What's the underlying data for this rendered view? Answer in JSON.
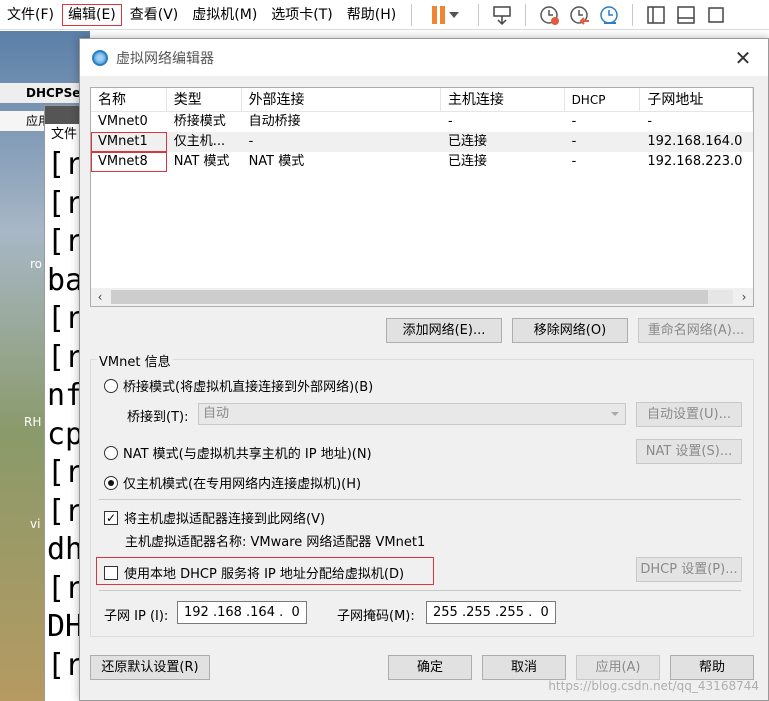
{
  "menubar": {
    "items": [
      "文件(F)",
      "编辑(E)",
      "查看(V)",
      "虚拟机(M)",
      "选项卡(T)",
      "帮助(H)"
    ],
    "highlighted_item": "编辑(E)",
    "accent_pause_color": "#f08533"
  },
  "background": {
    "vm_tab": "DHCPSer",
    "apps_menu": "应用程序",
    "terminal_menu": "文件",
    "terminal_lines": [
      "[r",
      "[r",
      "[r",
      "ba",
      "[r",
      "[r",
      "nf",
      "cp",
      "[r",
      "[r",
      "dh",
      "[r",
      "DH",
      "[r"
    ],
    "side_labels": [
      "ro",
      "RH",
      "vi"
    ]
  },
  "dialog": {
    "title": "虚拟网络编辑器",
    "close_icon": "close-icon",
    "table": {
      "headers": [
        "名称",
        "类型",
        "外部连接",
        "主机连接",
        "DHCP",
        "子网地址"
      ],
      "rows": [
        [
          "VMnet0",
          "桥接模式",
          "自动桥接",
          "-",
          "-",
          "-"
        ],
        [
          "VMnet1",
          "仅主机...",
          "-",
          "已连接",
          "-",
          "192.168.164.0"
        ],
        [
          "VMnet8",
          "NAT 模式",
          "NAT 模式",
          "已连接",
          "-",
          "192.168.223.0"
        ]
      ],
      "selected_row": "VMnet1",
      "highlighted_names": [
        "VMnet1",
        "VMnet8"
      ]
    },
    "buttons": {
      "add_network": "添加网络(E)...",
      "remove_network": "移除网络(O)",
      "rename_network": "重命名网络(A)..."
    },
    "vmnet_info": {
      "group_label": "VMnet 信息",
      "bridged_radio": "桥接模式(将虚拟机直接连接到外部网络)(B)",
      "bridge_to_label": "桥接到(T):",
      "bridge_to_value": "自动",
      "auto_settings": "自动设置(U)...",
      "nat_radio": "NAT 模式(与虚拟机共享主机的 IP 地址)(N)",
      "nat_settings": "NAT 设置(S)...",
      "hostonly_radio": "仅主机模式(在专用网络内连接虚拟机)(H)",
      "selected_mode": "hostonly",
      "connect_adapter_checkbox": "将主机虚拟适配器连接到此网络(V)",
      "connect_adapter_checked": true,
      "adapter_name_text": "主机虚拟适配器名称: VMware 网络适配器 VMnet1",
      "dhcp_checkbox": "使用本地 DHCP 服务将 IP 地址分配给虚拟机(D)",
      "dhcp_checked": false,
      "dhcp_settings": "DHCP 设置(P)...",
      "subnet_ip_label": "子网 IP (I):",
      "subnet_ip_value": "192 .168 .164 .  0",
      "subnet_mask_label": "子网掩码(M):",
      "subnet_mask_value": "255 .255 .255 .  0"
    },
    "footer": {
      "restore_defaults": "还原默认设置(R)",
      "ok": "确定",
      "cancel": "取消",
      "apply": "应用(A)",
      "help": "帮助"
    },
    "highlight_color": "#d9363e"
  },
  "watermark": "https://blog.csdn.net/qq_43168744"
}
